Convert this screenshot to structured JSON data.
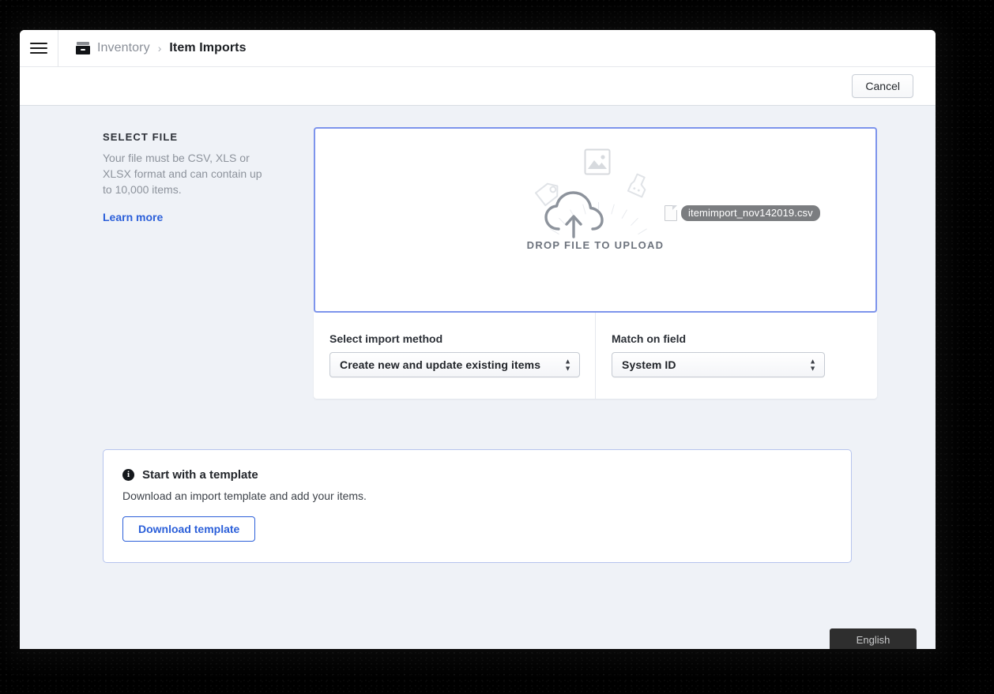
{
  "window": {
    "header": {
      "menu_icon": "hamburger-icon",
      "breadcrumb": {
        "app_icon": "inventory-box-icon",
        "parent": "Inventory",
        "separator": "›",
        "current": "Item Imports"
      }
    },
    "toolbar": {
      "cancel_label": "Cancel"
    }
  },
  "select_file": {
    "title": "SELECT FILE",
    "description": "Your file must be CSV, XLS or XLSX format and can contain up to 10,000 items.",
    "learn_more_label": "Learn more"
  },
  "dropzone": {
    "label": "DROP FILE TO UPLOAD",
    "cloud_icon": "cloud-upload-icon",
    "photo_icon": "image-icon",
    "tag_icon": "tag-icon",
    "plug_icon": "plug-icon",
    "dragged_file": {
      "doc_icon": "document-icon",
      "name": "itemimport_nov142019.csv"
    }
  },
  "options": {
    "import_method": {
      "label": "Select import method",
      "value": "Create new and update existing items"
    },
    "match_field": {
      "label": "Match on field",
      "value": "System ID"
    }
  },
  "template_panel": {
    "info_icon": "info-icon",
    "title": "Start with a template",
    "description": "Download an import template and add your items.",
    "button_label": "Download template"
  },
  "language_tab": {
    "label": "English"
  },
  "colors": {
    "accent_blue": "#2b5fd9",
    "dropzone_border": "#7d94ec",
    "panel_border": "#b6c4ee",
    "page_bg": "#eff2f7",
    "chip_bg": "#7b7d80",
    "lang_tab_bg": "#2e2e2e"
  }
}
